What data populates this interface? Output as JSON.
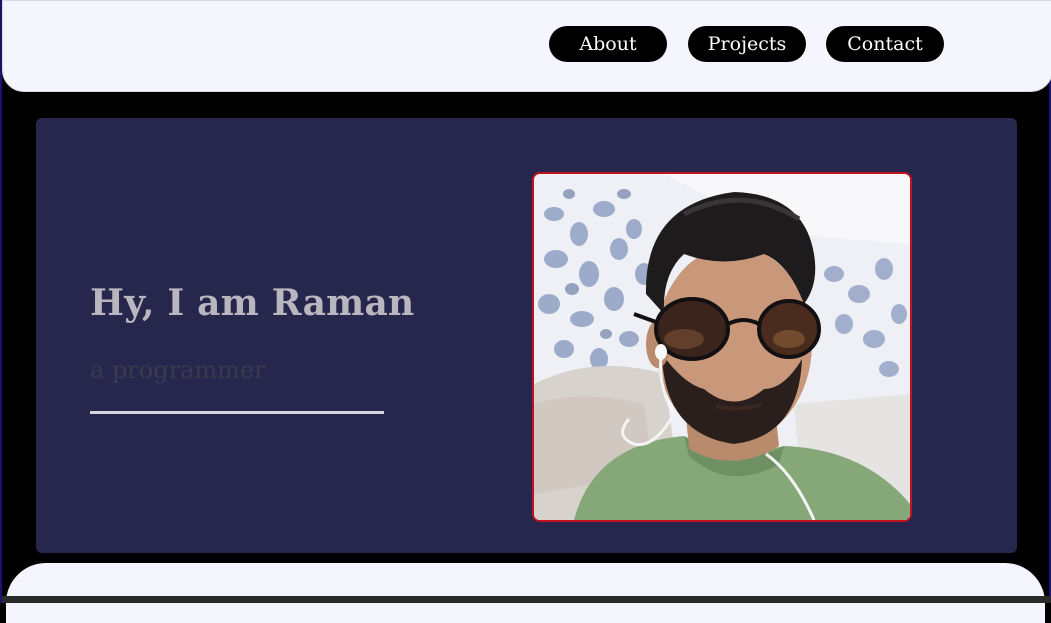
{
  "nav": {
    "items": [
      {
        "label": "About"
      },
      {
        "label": "Projects"
      },
      {
        "label": "Contact"
      }
    ]
  },
  "hero": {
    "title": "Hy, I am Raman",
    "subtitle": "a programmer"
  },
  "colors": {
    "nav_bg": "#f5f5fd",
    "page_bg": "#000000",
    "hero_bg": "#27264c",
    "title": "#b9b6bf",
    "subtitle": "#3b3a52",
    "photo_border": "#c1121f"
  },
  "profile_photo": {
    "icon": "portrait-photo"
  }
}
